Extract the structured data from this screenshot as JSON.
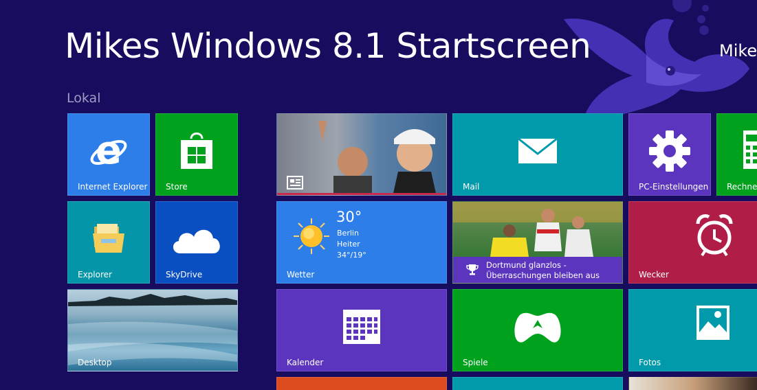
{
  "header": {
    "title": "Mikes Windows 8.1 Startscreen",
    "user": "Mike"
  },
  "group": {
    "label": "Lokal"
  },
  "tiles": {
    "internet_explorer": "Internet Explorer",
    "store": "Store",
    "explorer": "Explorer",
    "skydrive": "SkyDrive",
    "desktop": "Desktop",
    "mail": "Mail",
    "pc_settings": "PC-Einstellungen",
    "calculator": "Rechner",
    "weather": "Wetter",
    "alarm": "Wecker",
    "calendar": "Kalender",
    "games": "Spiele",
    "photos": "Fotos"
  },
  "weather": {
    "temp": "30°",
    "city": "Berlin",
    "condition": "Heiter",
    "range": "34°/19°"
  },
  "sports": {
    "headline": "Dortmund glanzlos - Überraschungen bleiben aus"
  },
  "colors": {
    "background": "#180c5e",
    "blue": "#2d7ee8",
    "green": "#00a21d",
    "teal": "#009aab",
    "purple": "#5b35bd",
    "crimson": "#b01e48",
    "orange": "#dc4c1f"
  }
}
